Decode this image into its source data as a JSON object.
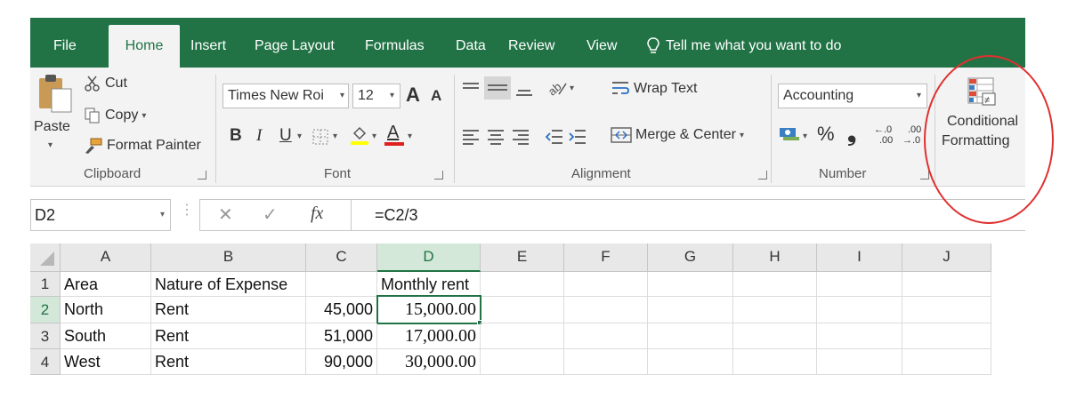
{
  "tabs": {
    "file": "File",
    "home": "Home",
    "insert": "Insert",
    "page_layout": "Page Layout",
    "formulas": "Formulas",
    "data": "Data",
    "review": "Review",
    "view": "View",
    "tell_me": "Tell me what you want to do"
  },
  "clipboard": {
    "paste": "Paste",
    "cut": "Cut",
    "copy": "Copy",
    "format_painter": "Format Painter",
    "label": "Clipboard"
  },
  "font": {
    "family": "Times New Roi",
    "size": "12",
    "bold": "B",
    "italic": "I",
    "underline": "U",
    "grow": "A",
    "shrink": "A",
    "font_color": "A",
    "label": "Font"
  },
  "alignment": {
    "wrap_text": "Wrap Text",
    "merge_center": "Merge & Center",
    "label": "Alignment"
  },
  "number": {
    "format": "Accounting",
    "percent": "%",
    "comma": "❟",
    "inc_decimal_top": "←.0",
    "inc_decimal_bottom": ".00",
    "dec_decimal_top": ".00",
    "dec_decimal_bottom": "→.0",
    "label": "Number"
  },
  "styles": {
    "conditional_line1": "Conditional",
    "conditional_line2": "Formatting"
  },
  "formula_bar": {
    "name_box": "D2",
    "cancel": "✕",
    "enter": "✓",
    "fx": "fx",
    "formula": "=C2/3"
  },
  "sheet": {
    "columns": [
      "A",
      "B",
      "C",
      "D",
      "E",
      "F",
      "G",
      "H",
      "I",
      "J"
    ],
    "rows": [
      "1",
      "2",
      "3",
      "4"
    ],
    "cells": {
      "A1": "Area",
      "B1": "Nature of Expense",
      "C1": "",
      "D1": "Monthly rent",
      "A2": "North",
      "B2": "Rent",
      "C2": "45,000",
      "D2": "15,000.00",
      "A3": "South",
      "B3": "Rent",
      "C3": "51,000",
      "D3": "17,000.00",
      "A4": "West",
      "B4": "Rent",
      "C4": "90,000",
      "D4": "30,000.00"
    }
  },
  "colors": {
    "excel_green": "#217346",
    "ribbon_bg": "#f3f3f3",
    "annotation_red": "#e03030"
  }
}
